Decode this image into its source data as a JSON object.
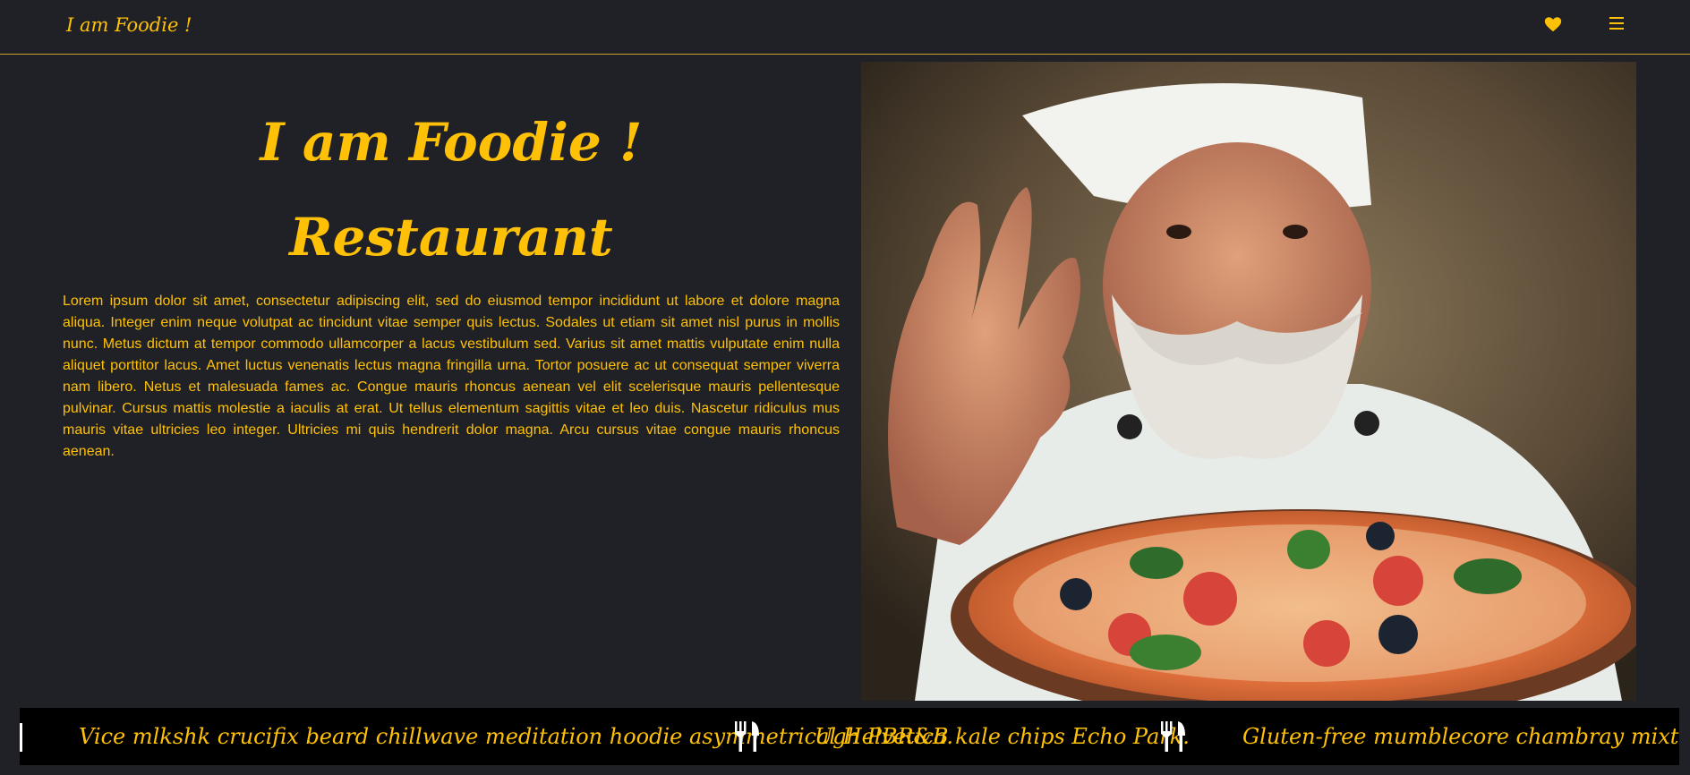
{
  "nav": {
    "brand": "I am Foodie !",
    "icons": {
      "favorites": "heart-icon",
      "menu": "hamburger-menu-icon"
    },
    "accent": "#ffc107"
  },
  "hero": {
    "title_line1": "I am Foodie !",
    "title_line2": "Restaurant",
    "body": "Lorem ipsum dolor sit amet, consectetur adipiscing elit, sed do eiusmod tempor incididunt ut labore et dolore magna aliqua. Integer enim neque volutpat ac tincidunt vitae semper quis lectus. Sodales ut etiam sit amet nisl purus in mollis nunc. Metus dictum at tempor commodo ullamcorper a lacus vestibulum sed. Varius sit amet mattis vulputate enim nulla aliquet porttitor lacus. Amet luctus venenatis lectus magna fringilla urna. Tortor posuere ac ut consequat semper viverra nam libero. Netus et malesuada fames ac. Congue mauris rhoncus aenean vel elit scelerisque mauris pellentesque pulvinar. Cursus mattis molestie a iaculis at erat. Ut tellus elementum sagittis vitae et leo duis. Nascetur ridiculus mus mauris vitae ultricies leo integer. Ultricies mi quis hendrerit dolor magna. Arcu cursus vitae congue mauris rhoncus aenean."
  },
  "ticker": {
    "items": [
      "Vice mlkshk crucifix beard chillwave meditation hoodie asymmetrical Helvetica.",
      "Ugh PBR&B kale chips Echo Park.",
      "Gluten-free mumblecore chambray mixtape food truck."
    ],
    "separator_icon": "fork-knife-icon"
  },
  "colors": {
    "background": "#1f2126",
    "accent": "#ffc107",
    "ticker_bg": "#000000"
  }
}
